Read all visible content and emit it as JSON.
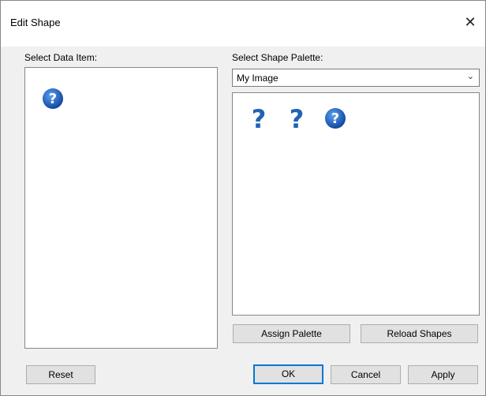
{
  "window": {
    "title": "Edit Shape",
    "close_glyph": "✕"
  },
  "left_panel": {
    "label": "Select Data Item:",
    "selected_icon": "question-circle-icon"
  },
  "right_panel": {
    "label": "Select Shape Palette:",
    "palette_select": {
      "value": "My Image"
    },
    "shapes": [
      "question-mark-icon",
      "question-mark-icon",
      "question-circle-icon"
    ]
  },
  "buttons": {
    "assign_palette": "Assign Palette",
    "reload_shapes": "Reload Shapes",
    "reset": "Reset",
    "ok": "OK",
    "cancel": "Cancel",
    "apply": "Apply"
  },
  "colors": {
    "accent": "#0078d7",
    "icon_blue": "#1f63b8"
  }
}
